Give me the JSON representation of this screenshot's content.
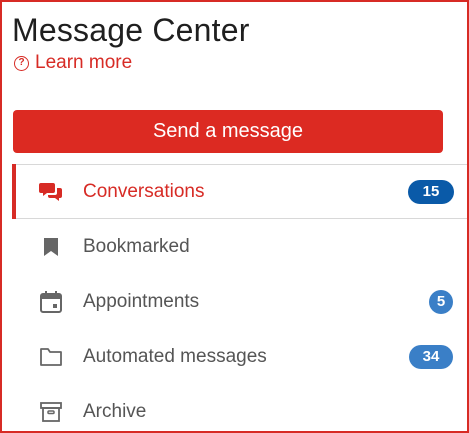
{
  "header": {
    "title": "Message Center",
    "learn_more": "Learn more",
    "learn_more_icon": "help-circle-icon"
  },
  "actions": {
    "send_message": "Send a message"
  },
  "nav": {
    "items": [
      {
        "label": "Conversations",
        "icon": "chat-bubbles-icon",
        "badge": "15",
        "active": true
      },
      {
        "label": "Bookmarked",
        "icon": "bookmark-icon",
        "badge": null,
        "active": false
      },
      {
        "label": "Appointments",
        "icon": "calendar-icon",
        "badge": "5",
        "active": false
      },
      {
        "label": "Automated messages",
        "icon": "folder-icon",
        "badge": "34",
        "active": false
      },
      {
        "label": "Archive",
        "icon": "archive-box-icon",
        "badge": null,
        "active": false
      }
    ]
  },
  "colors": {
    "accent": "#d72b25",
    "badge_blue": "#3a7fc7",
    "badge_dark_blue": "#0a5aa8",
    "icon_gray": "#666666"
  }
}
